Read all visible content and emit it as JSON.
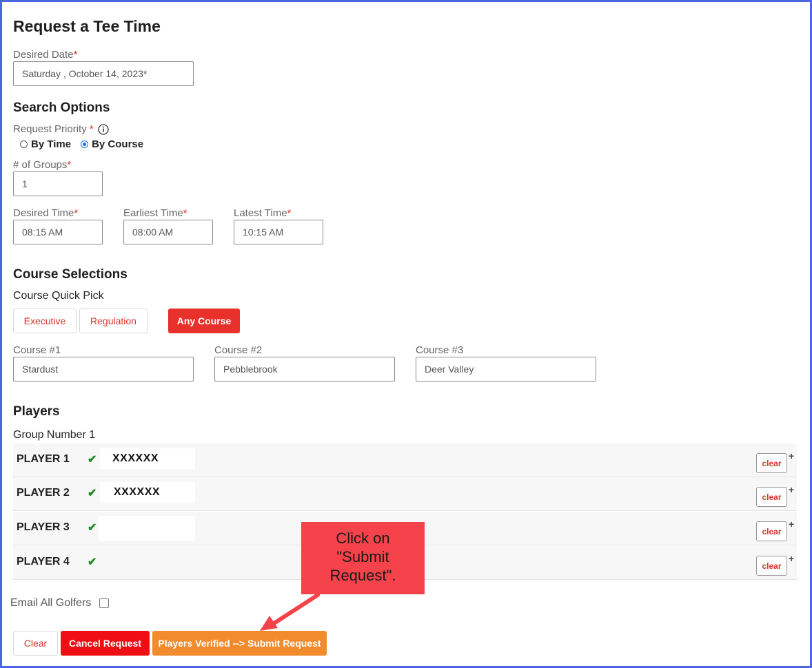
{
  "page": {
    "title": "Request a Tee Time"
  },
  "date": {
    "label": "Desired Date",
    "value": "Saturday , October 14, 2023*"
  },
  "search": {
    "heading": "Search Options",
    "priority_label": "Request Priority",
    "options": [
      {
        "label": "By Time",
        "checked": false
      },
      {
        "label": "By Course",
        "checked": true
      }
    ],
    "groups_label": "# of Groups",
    "groups_value": "1",
    "desired_label": "Desired Time",
    "desired_value": "08:15 AM",
    "earliest_label": "Earliest Time",
    "earliest_value": "08:00 AM",
    "latest_label": "Latest Time",
    "latest_value": "10:15 AM"
  },
  "courses": {
    "heading": "Course Selections",
    "quick_pick_label": "Course Quick Pick",
    "quick_picks": [
      "Executive",
      "Regulation",
      "Any Course"
    ],
    "fields": [
      {
        "label": "Course #1",
        "value": "Stardust"
      },
      {
        "label": "Course #2",
        "value": "Pebblebrook"
      },
      {
        "label": "Course #3",
        "value": "Deer Valley"
      }
    ]
  },
  "players": {
    "heading": "Players",
    "group_label": "Group Number 1",
    "rows": [
      {
        "label": "PLAYER 1",
        "name": "XXXXXX"
      },
      {
        "label": "PLAYER 2",
        "name": "XXXXXX"
      },
      {
        "label": "PLAYER 3",
        "name": ""
      },
      {
        "label": "PLAYER 4",
        "name": ""
      }
    ],
    "clear_label": "clear",
    "plus": "+",
    "check": "✔"
  },
  "email": {
    "label": "Email All Golfers"
  },
  "actions": {
    "clear": "Clear",
    "cancel": "Cancel Request",
    "submit": "Players Verified --> Submit Request"
  },
  "callout": {
    "text_line1": "Click on",
    "text_line2": "\"Submit",
    "text_line3": "Request\"."
  },
  "colors": {
    "accent_red": "#e8312a",
    "callout_red": "#f6434b",
    "submit_orange": "#f28b2d",
    "frame_blue": "#4a66e0",
    "check_green": "#1f8a1f"
  }
}
